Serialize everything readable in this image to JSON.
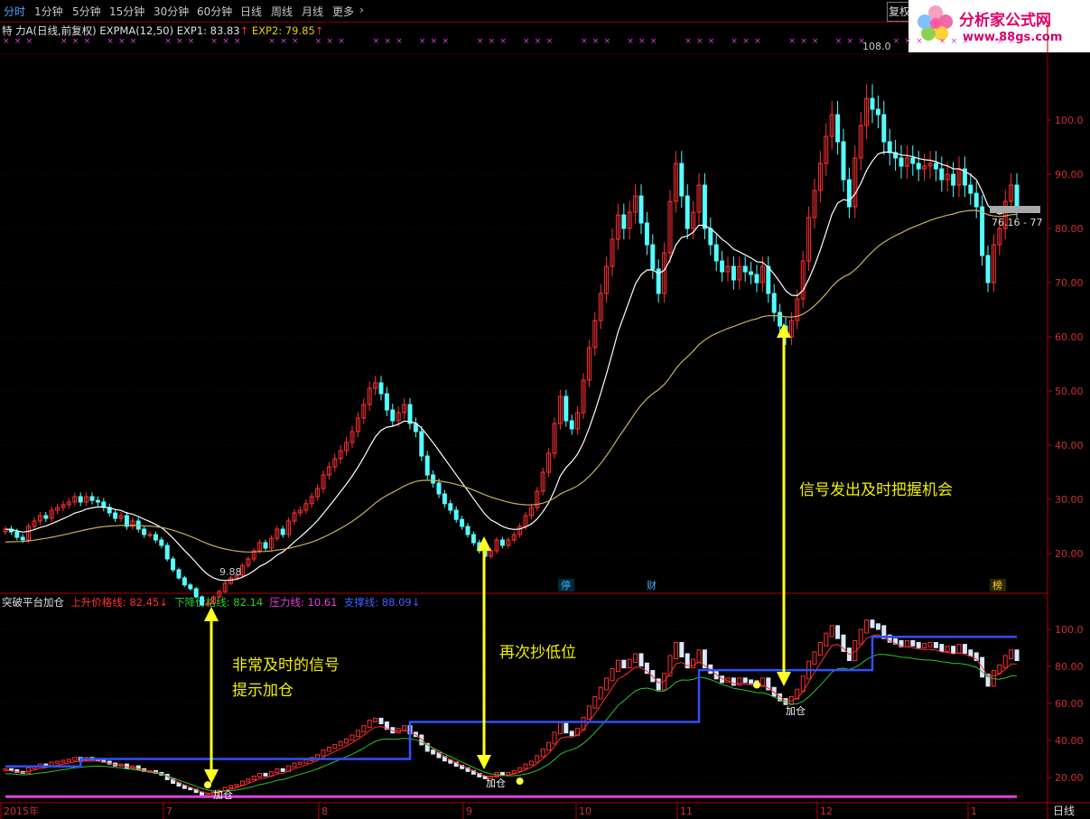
{
  "toolbar": {
    "tabs": [
      "分时",
      "1分钟",
      "5分钟",
      "15分钟",
      "30分钟",
      "60分钟",
      "日线",
      "周线",
      "月线",
      "更多"
    ],
    "more_arrow": "›",
    "restore_label": "复权"
  },
  "logo": {
    "brand": "分析家公式网",
    "url": "www.88gs.com"
  },
  "main_legend": {
    "stock": "特 力A",
    "mode": "(日线,前复权)",
    "indicator": "EXPMA(12,50)",
    "exp1_label": "EXP1: 83.83",
    "exp2_label": "EXP2: 79.85",
    "arrow": "↑"
  },
  "sub_legend": {
    "name": "突破平台加仓",
    "up_label": "上升价格线: 82.45",
    "down_label": "下降价格线: 82.14",
    "press_label": "压力线: 10.61",
    "support_label": "支撑线: 88.09",
    "arrow": "↓"
  },
  "annotations": {
    "text1_line1": "非常及时的信号",
    "text1_line2": "提示加仓",
    "text2": "再次抄低位",
    "text3": "信号发出及时把握机会",
    "add_label": "加仓",
    "high_label": "108.0",
    "low_label": "9.88",
    "last_label": "76.16 - 77",
    "event1": "停",
    "event2": "财",
    "event3": "榜"
  },
  "x_axis": {
    "labels": [
      "2015年",
      "7",
      "8",
      "9",
      "10",
      "11",
      "12",
      "1"
    ],
    "period": "日线"
  },
  "chart_data": [
    {
      "type": "candlestick",
      "title": "特力A 日线",
      "ylim": [
        5,
        112
      ],
      "y_ticks": [
        "20.00",
        "30.00",
        "40.00",
        "50.00",
        "60.00",
        "70.00",
        "80.00",
        "90.00",
        "100.0"
      ],
      "series": [
        {
          "name": "EXP1",
          "color": "#ffffff"
        },
        {
          "name": "EXP2",
          "color": "#c8b060"
        }
      ],
      "close": [
        24.5,
        24,
        23,
        22.5,
        25,
        26,
        27,
        26.5,
        28,
        28.5,
        29,
        29.5,
        30.5,
        29.5,
        30.5,
        29.8,
        29.5,
        28.5,
        27.5,
        26.5,
        27,
        25,
        26,
        24.5,
        23.5,
        23.5,
        22.5,
        21.5,
        19,
        17,
        15.5,
        14.2,
        13.5,
        12,
        10.5,
        10.8,
        12,
        13,
        14.5,
        15.5,
        16,
        17.8,
        19,
        20.5,
        22,
        21,
        22.8,
        24.5,
        23.5,
        26,
        27.5,
        28,
        29.2,
        30.5,
        32,
        34.5,
        36,
        37.5,
        39,
        40.5,
        42.5,
        45,
        47.5,
        50.5,
        51.5,
        49.5,
        46.5,
        44.5,
        46,
        47.5,
        44,
        42.5,
        38,
        34.5,
        33,
        31,
        29.2,
        28,
        26.3,
        25,
        23.5,
        22,
        20.5,
        19.5,
        20.5,
        22.5,
        21.5,
        22.5,
        23.5,
        25,
        27,
        28.5,
        31.5,
        35,
        38.5,
        44,
        49,
        44.5,
        43,
        46,
        52,
        58,
        63,
        68,
        73,
        78,
        82.5,
        80,
        83,
        86,
        81,
        77,
        72.5,
        68,
        75.5,
        85,
        92,
        86,
        80,
        83,
        88,
        80,
        77,
        74,
        72,
        73,
        70.5,
        73,
        72,
        71.5,
        70,
        73,
        68,
        64.5,
        62,
        60,
        63,
        67,
        74,
        82,
        87,
        92,
        97,
        101,
        96,
        89,
        84,
        93,
        99,
        104,
        102,
        101,
        96,
        94,
        93,
        91.5,
        93,
        92,
        91,
        91.5,
        92,
        91,
        89,
        90,
        88,
        91,
        88,
        86.5,
        84,
        75,
        70,
        77,
        80,
        85,
        88,
        84
      ],
      "exp1_end": 83.83,
      "exp2_end": 79.85,
      "high": 108.0,
      "low": 9.88,
      "last_range": "76.16 - 77"
    },
    {
      "type": "line",
      "title": "突破平台加仓",
      "ylim": [
        5,
        112
      ],
      "y_ticks": [
        "20.00",
        "40.00",
        "60.00",
        "80.00",
        "100.0"
      ],
      "series": [
        {
          "name": "上升价格线",
          "color": "#ff3030",
          "last": 82.45
        },
        {
          "name": "下降价格线",
          "color": "#30c030",
          "last": 82.14
        },
        {
          "name": "压力线",
          "color": "#e040e0",
          "last": 10.61
        },
        {
          "name": "支撑线",
          "color": "#3050ff",
          "last": 88.09
        }
      ],
      "support_steps": [
        [
          0,
          26
        ],
        [
          13,
          30
        ],
        [
          70,
          50
        ],
        [
          120,
          78
        ],
        [
          150,
          96
        ]
      ],
      "signals": [
        "加仓",
        "加仓",
        "加仓"
      ]
    }
  ],
  "colors": {
    "up": "#ff3030",
    "down": "#54ffff",
    "axis": "#b00000",
    "exp1": "#ffffff",
    "exp2": "#c8b060",
    "arrow": "#ffff20"
  }
}
